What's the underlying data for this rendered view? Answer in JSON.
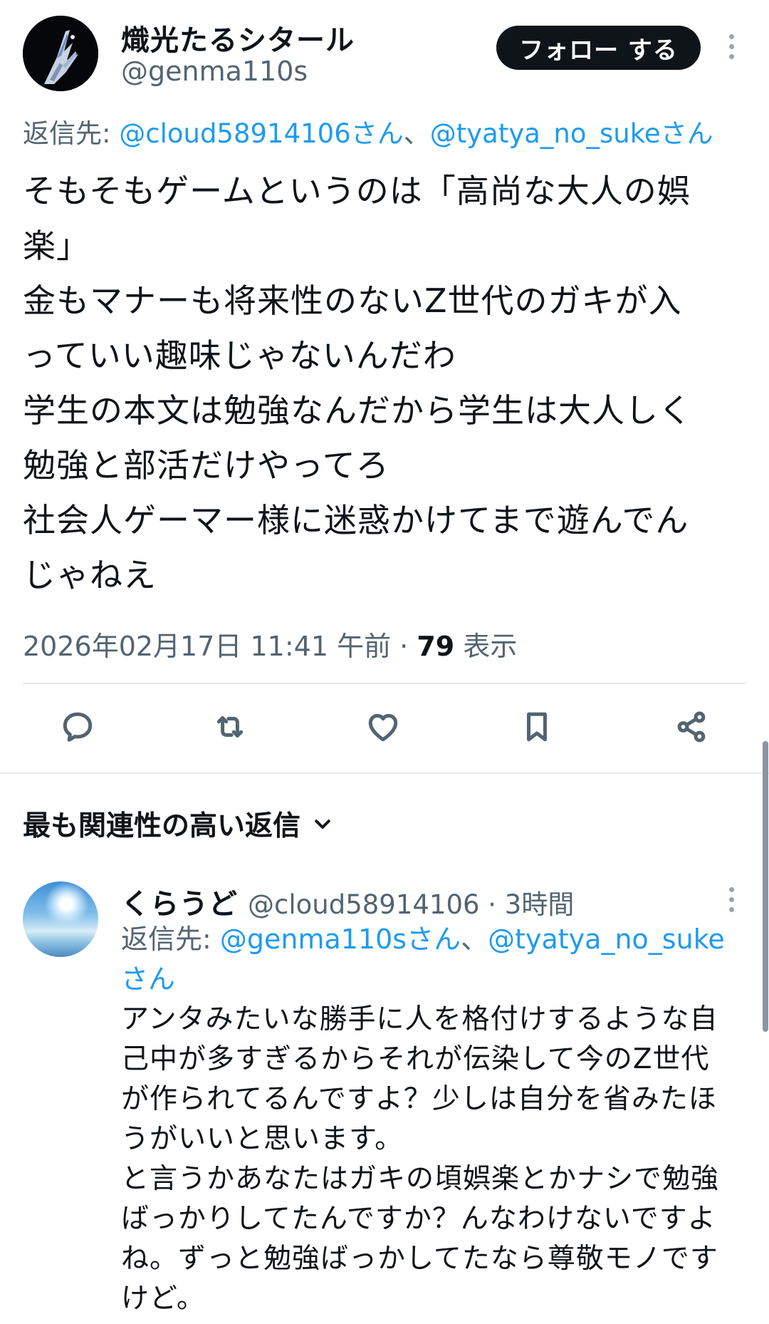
{
  "author": {
    "display_name": "熾光たるシタール",
    "handle": "@genma110s",
    "follow_label": "フォロー する"
  },
  "reply_to": {
    "prefix": "返信先: ",
    "mention1": "@cloud58914106さん",
    "separator": "、",
    "mention2": "@tyatya_no_sukeさん"
  },
  "tweet": {
    "lines": [
      "そもそもゲームというのは「高尚な大人の娯",
      "楽」",
      "金もマナーも将来性のないZ世代のガキが入",
      "っていい趣味じゃないんだわ",
      "学生の本文は勉強なんだから学生は大人しく",
      "勉強と部活だけやってろ",
      "社会人ゲーマー様に迷惑かけてまで遊んでん",
      "じゃねえ"
    ],
    "timestamp": "2026年02月17日 11:41 午前",
    "dot": " · ",
    "views_count": "79",
    "views_label": " 表示"
  },
  "actions": {
    "icons": [
      "reply-icon",
      "retweet-icon",
      "like-icon",
      "bookmark-icon",
      "share-icon"
    ]
  },
  "sort": {
    "label": "最も関連性の高い返信"
  },
  "reply": {
    "display_name": "くらうど",
    "handle_time": "@cloud58914106 · 3時間",
    "reply_to_prefix": "返信先: ",
    "mention1": "@genma110sさん",
    "separator": "、",
    "mention2": "@tyatya_no_suke",
    "mention2_cont": "さん",
    "lines": [
      "アンタみたいな勝手に人を格付けするような自",
      "己中が多すぎるからそれが伝染して今のZ世代",
      "が作られてるんですよ？少しは自分を省みたほ",
      "うがいいと思います。",
      "と言うかあなたはガキの頃娯楽とかナシで勉強",
      "ばっかりしてたんですか？んなわけないですよ",
      "ね。ずっと勉強ばっかしてたなら尊敬モノです",
      "けど。"
    ]
  },
  "colors": {
    "text": "#0f1419",
    "secondary": "#536471",
    "link": "#1d9bf0",
    "divider": "#e6e9eb",
    "button": "#0f1419"
  }
}
